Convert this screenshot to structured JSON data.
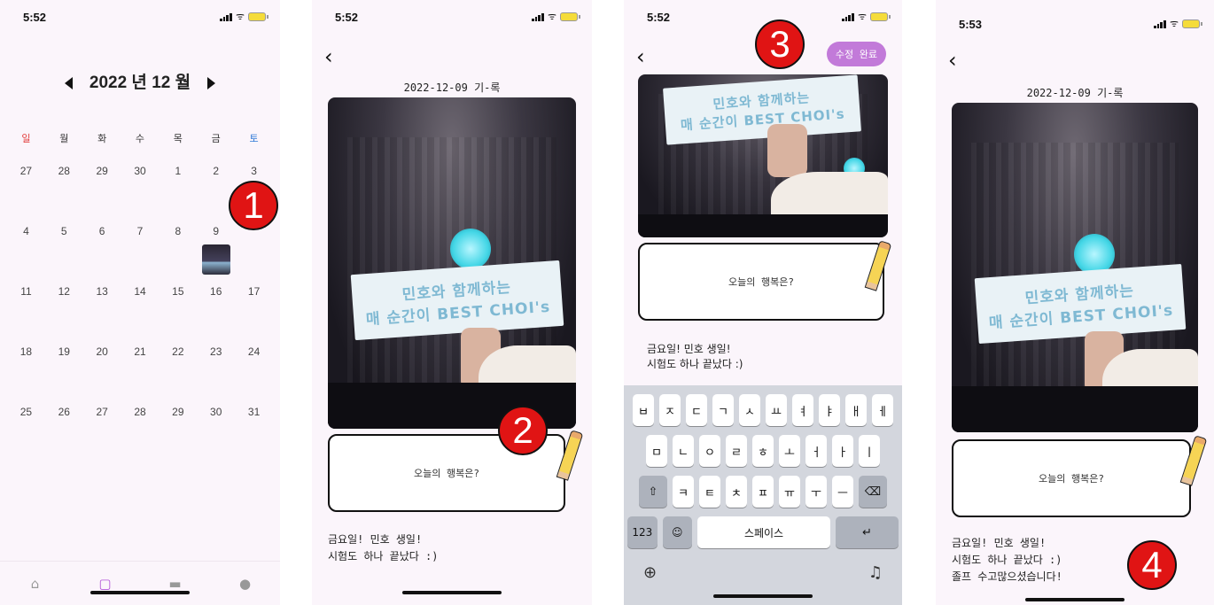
{
  "status": {
    "time1": "5:52",
    "time2": "5:52",
    "time3": "5:52",
    "time4": "5:53",
    "wifi_glyph": "ᯤ"
  },
  "calendar": {
    "prev_glyph": "◀",
    "next_glyph": "▶",
    "month_label": "2022 년 12 월",
    "weekdays": [
      "일",
      "월",
      "화",
      "수",
      "목",
      "금",
      "토"
    ],
    "weeks": [
      [
        "27",
        "28",
        "29",
        "30",
        "1",
        "2",
        "3"
      ],
      [
        "4",
        "5",
        "6",
        "7",
        "8",
        "9",
        ""
      ],
      [
        "11",
        "12",
        "13",
        "14",
        "15",
        "16",
        "17"
      ],
      [
        "18",
        "19",
        "20",
        "21",
        "22",
        "23",
        "24"
      ],
      [
        "25",
        "26",
        "27",
        "28",
        "29",
        "30",
        "31"
      ]
    ]
  },
  "tabs": [
    {
      "icon": "home-icon",
      "glyph": "⌂"
    },
    {
      "icon": "calendar-icon",
      "glyph": "▢"
    },
    {
      "icon": "truck-icon",
      "glyph": "▬"
    },
    {
      "icon": "person-icon",
      "glyph": "●"
    }
  ],
  "diary": {
    "back_glyph": "‹",
    "date_title": "2022-12-09 기-록",
    "banner_line1": "민호와 함께하는",
    "banner_line2": "매 순간이 BEST CHOI's",
    "prompt": "오늘의 행복은?",
    "entry_line1": "금요일! 민호 생일!",
    "entry_line2": "시험도 하나 끝났다 :)",
    "entry_line3": "졸프 수고많으셨습니다!"
  },
  "edit": {
    "save_label": "수정 완료"
  },
  "keyboard": {
    "row1": [
      "ㅂ",
      "ㅈ",
      "ㄷ",
      "ㄱ",
      "ㅅ",
      "ㅛ",
      "ㅕ",
      "ㅑ",
      "ㅐ",
      "ㅔ"
    ],
    "row2": [
      "ㅁ",
      "ㄴ",
      "ㅇ",
      "ㄹ",
      "ㅎ",
      "ㅗ",
      "ㅓ",
      "ㅏ",
      "ㅣ"
    ],
    "row3": [
      "ㅋ",
      "ㅌ",
      "ㅊ",
      "ㅍ",
      "ㅠ",
      "ㅜ",
      "ㅡ"
    ],
    "shift_glyph": "⇧",
    "backspace_glyph": "⌫",
    "numbers_label": "123",
    "emoji_glyph": "☺",
    "space_label": "스페이스",
    "return_glyph": "↵",
    "globe_glyph": "⊕",
    "mic_glyph": "♫"
  },
  "steps": [
    "1",
    "2",
    "3",
    "4"
  ],
  "colors": {
    "accent": "#b254d8",
    "badge": "#e01414",
    "sunday": "#e23a3a",
    "saturday": "#2d78d6"
  }
}
